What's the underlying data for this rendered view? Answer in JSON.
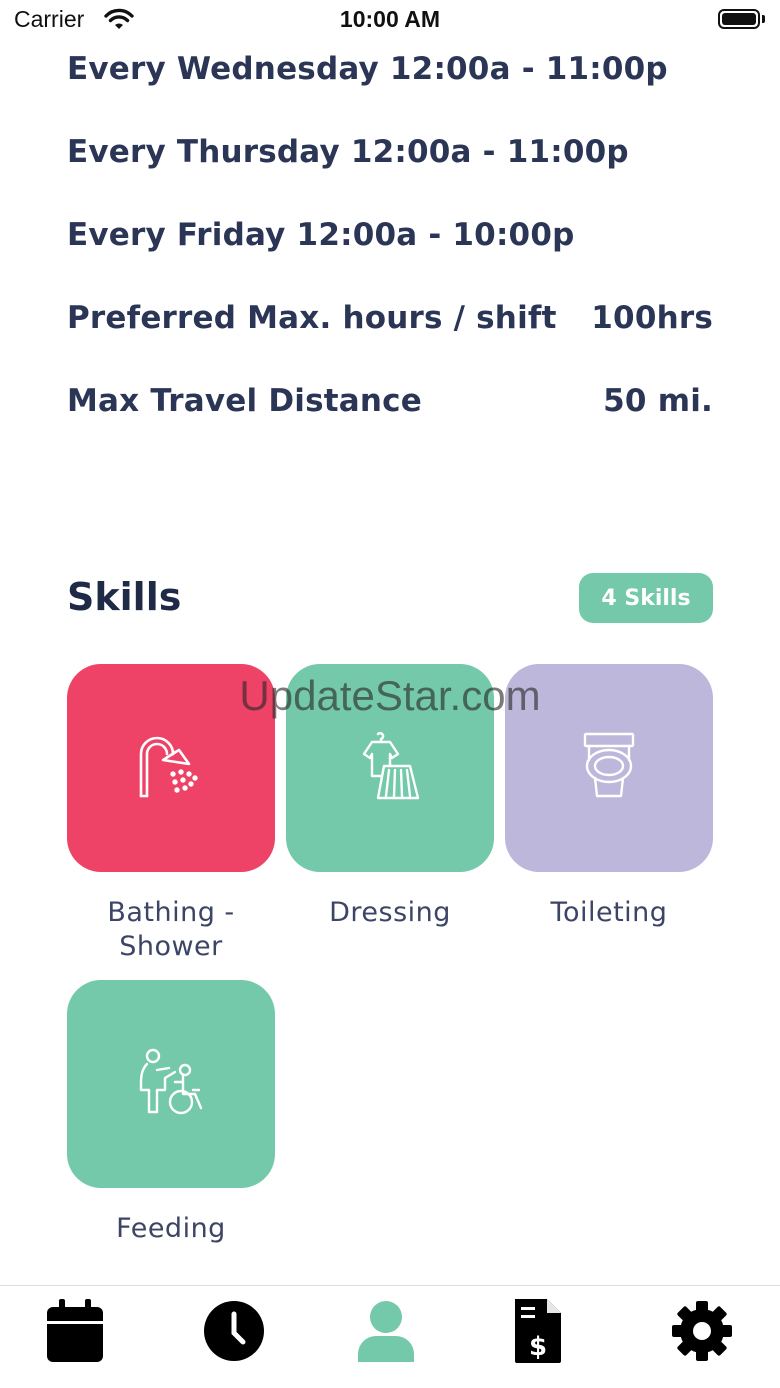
{
  "status_bar": {
    "carrier": "Carrier",
    "time": "10:00 AM"
  },
  "availability": [
    {
      "label": "Every Wednesday 12:00a - 11:00p"
    },
    {
      "label": "Every Thursday 12:00a - 11:00p"
    },
    {
      "label": "Every Friday 12:00a - 10:00p"
    }
  ],
  "preferences": {
    "max_hours_label": "Preferred Max. hours / shift",
    "max_hours_value": "100hrs",
    "travel_label": "Max Travel Distance",
    "travel_value": "50 mi."
  },
  "skills": {
    "title": "Skills",
    "badge": "4 Skills",
    "items": [
      {
        "label": "Bathing -\nShower",
        "icon": "shower-icon",
        "color": "#ee4266"
      },
      {
        "label": "Dressing",
        "icon": "clothes-icon",
        "color": "#74c9ab"
      },
      {
        "label": "Toileting",
        "icon": "toilet-icon",
        "color": "#bdb8db"
      },
      {
        "label": "Feeding",
        "icon": "caregiver-wheelchair-icon",
        "color": "#74c9ab"
      }
    ]
  },
  "watermark": "UpdateStar.com",
  "tabbar": {
    "items": [
      {
        "icon": "calendar-icon",
        "active": false
      },
      {
        "icon": "clock-icon",
        "active": false
      },
      {
        "icon": "profile-icon",
        "active": true
      },
      {
        "icon": "invoice-icon",
        "active": false
      },
      {
        "icon": "gear-icon",
        "active": false
      }
    ],
    "active_color": "#74c9ab",
    "inactive_color": "#000000"
  }
}
